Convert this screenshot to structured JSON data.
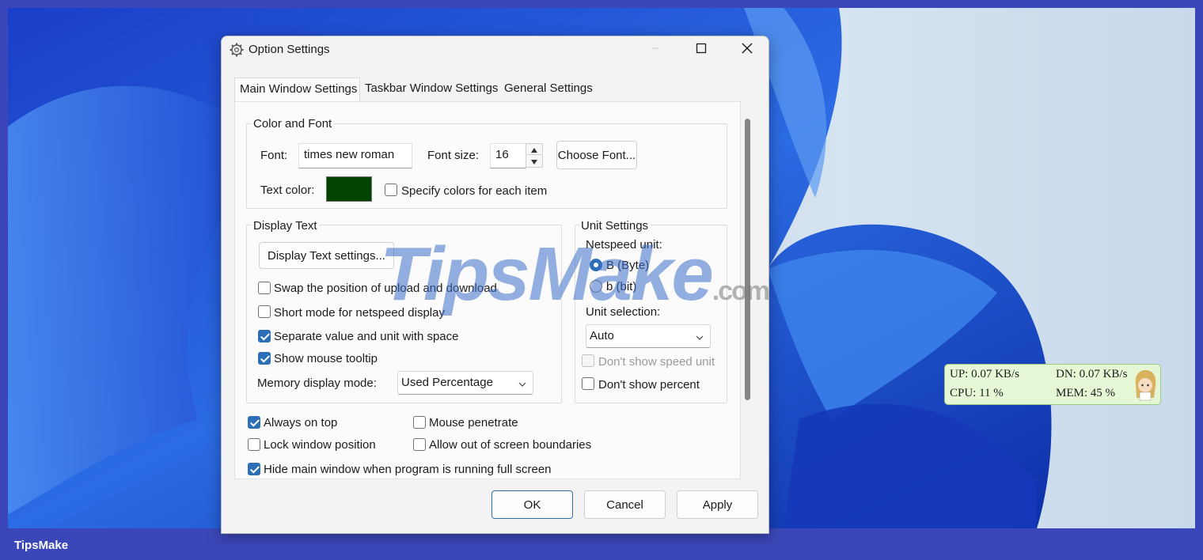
{
  "dialog": {
    "title": "Option Settings",
    "tabs": [
      "Main Window Settings",
      "Taskbar Window Settings",
      "General Settings"
    ],
    "active_tab": "Main Window Settings"
  },
  "color_font": {
    "group_label": "Color and Font",
    "font_label": "Font:",
    "font_value": "times new roman",
    "font_size_label": "Font size:",
    "font_size_value": "16",
    "choose_font_label": "Choose Font...",
    "text_color_label": "Text color:",
    "text_color": "#004400",
    "specify_colors_label": "Specify colors for each item",
    "specify_colors_checked": false
  },
  "display_text": {
    "group_label": "Display Text",
    "settings_button": "Display Text settings...",
    "options": [
      {
        "label": "Swap the position of upload and download",
        "checked": false
      },
      {
        "label": "Short mode for netspeed display",
        "checked": false
      },
      {
        "label": "Separate value and unit with space",
        "checked": true
      },
      {
        "label": "Show mouse tooltip",
        "checked": true
      }
    ],
    "memory_mode_label": "Memory display mode:",
    "memory_mode_value": "Used Percentage"
  },
  "unit_settings": {
    "group_label": "Unit Settings",
    "netspeed_label": "Netspeed unit:",
    "radio_byte": "B (Byte)",
    "radio_bit": "b (bit)",
    "selected": "B (Byte)",
    "unit_selection_label": "Unit selection:",
    "unit_selection_value": "Auto",
    "dont_show_speed_unit": "Don't show speed unit",
    "dont_show_percent": "Don't show percent"
  },
  "general_options": {
    "always_on_top": "Always on top",
    "mouse_penetrate": "Mouse penetrate",
    "lock_window": "Lock window position",
    "allow_out_of_screen": "Allow out of screen boundaries",
    "hide_fullscreen": "Hide main window when program is running full screen"
  },
  "buttons": {
    "ok": "OK",
    "cancel": "Cancel",
    "apply": "Apply"
  },
  "watermark": {
    "main": "TipsMake",
    "suffix": ".com"
  },
  "footer_brand": "TipsMake",
  "net_widget": {
    "up": "UP: 0.07 KB/s",
    "dn": "DN: 0.07 KB/s",
    "cpu": "CPU: 11 %",
    "mem": "MEM: 45 %"
  },
  "colors": {
    "accent": "#2c6fb7",
    "page_border": "#3b47b9",
    "widget_bg": "#e6f7d6"
  }
}
